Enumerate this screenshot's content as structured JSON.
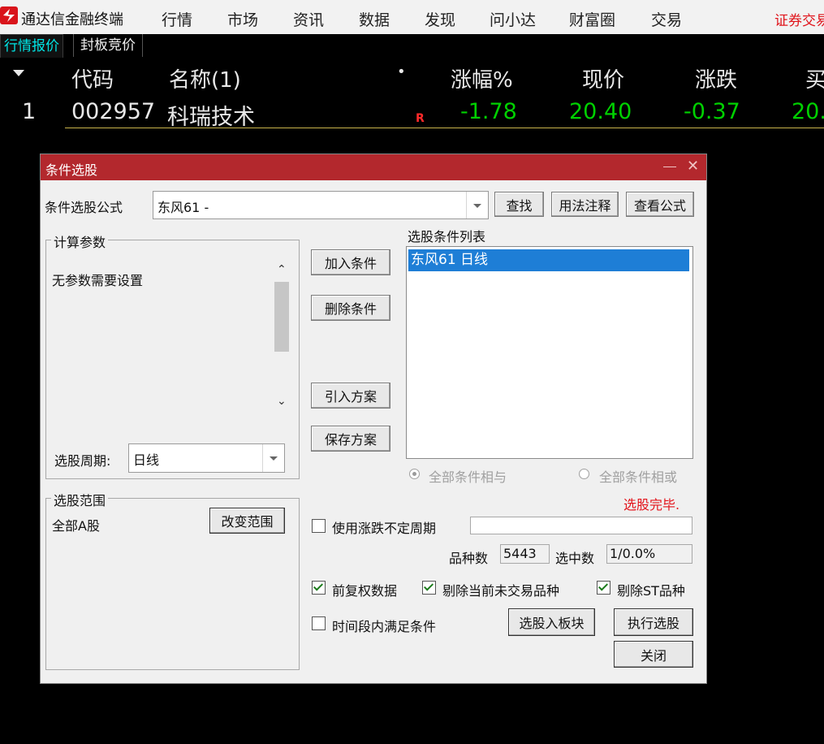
{
  "menubar": {
    "app_name": "通达信金融终端",
    "items": [
      "行情",
      "市场",
      "资讯",
      "数据",
      "发现",
      "问小达",
      "财富圈",
      "交易"
    ],
    "broker": "证券交易"
  },
  "subtabs": [
    "行情报价",
    "封板竞价"
  ],
  "grid": {
    "headers": {
      "code": "代码",
      "name": "名称(1)",
      "dot": "•",
      "change_pct": "涨幅%",
      "price": "现价",
      "change": "涨跌",
      "bid": "买"
    },
    "rows": [
      {
        "index": "1",
        "code": "002957",
        "name": "科瑞技术",
        "flag": "R",
        "change_pct": "-1.78",
        "price": "20.40",
        "change": "-0.37",
        "bid": "20."
      }
    ]
  },
  "dialog": {
    "title": "条件选股",
    "formula_label": "条件选股公式",
    "formula_value": "东风61  -",
    "find_button": "查找",
    "usage_button": "用法注释",
    "view_formula_button": "查看公式",
    "params_group": "计算参数",
    "params_text": "无参数需要设置",
    "period_label": "选股周期:",
    "period_value": "日线",
    "add_condition": "加入条件",
    "delete_condition": "删除条件",
    "import_plan": "引入方案",
    "save_plan": "保存方案",
    "condition_list_label": "选股条件列表",
    "conditions": [
      "东风61  日线"
    ],
    "radio_and": "全部条件相与",
    "radio_or": "全部条件相或",
    "status": "选股完毕.",
    "scope_group": "选股范围",
    "scope_value": "全部A股",
    "change_scope": "改变范围",
    "use_uncertain_period": "使用涨跌不定周期",
    "count_label": "品种数",
    "count_value": "5443",
    "selected_label": "选中数",
    "selected_value": "1/0.0%",
    "pre_adjust": "前复权数据",
    "exclude_untraded": "剔除当前未交易品种",
    "exclude_st": "剔除ST品种",
    "time_range": "时间段内满足条件",
    "to_block": "选股入板块",
    "execute": "执行选股",
    "close": "关闭"
  },
  "colors": {
    "title_bar": "#b3282d",
    "selection": "#1e7ed6",
    "down_green": "#00d100",
    "status_red": "#e3141b"
  },
  "icons": [
    "app-logo-icon",
    "sort-arrow-icon",
    "minimize-icon",
    "close-icon",
    "dropdown-arrow-icon",
    "scroll-up-icon",
    "scroll-down-icon"
  ]
}
